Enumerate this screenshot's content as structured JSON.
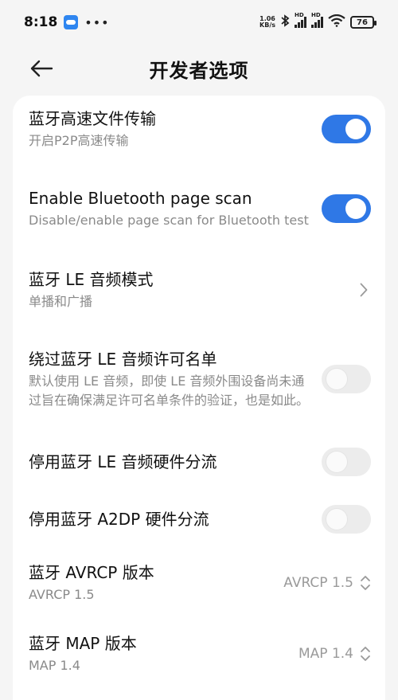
{
  "status_bar": {
    "time": "8:18",
    "net_speed_value": "1.06",
    "net_speed_unit": "KB/s",
    "signal1_label": "HD",
    "signal2_label": "HD",
    "battery": "76",
    "icons": [
      "cloud-icon",
      "more-dots-icon",
      "bluetooth-icon",
      "signal-icon",
      "wifi-icon",
      "battery-icon"
    ]
  },
  "header": {
    "title": "开发者选项"
  },
  "settings": {
    "bt_hs_transfer": {
      "title": "蓝牙高速文件传输",
      "subtitle": "开启P2P高速传输",
      "enabled": true
    },
    "bt_page_scan": {
      "title": "Enable Bluetooth page scan",
      "subtitle": "Disable/enable page scan for Bluetooth test",
      "enabled": true
    },
    "le_audio_mode": {
      "title": "蓝牙 LE 音频模式",
      "subtitle": "单播和广播"
    },
    "bypass_le_allowlist": {
      "title": "绕过蓝牙 LE 音频许可名单",
      "subtitle": "默认使用 LE 音频，即使 LE 音频外围设备尚未通过旨在确保满足许可名单条件的验证，也是如此。",
      "enabled": false
    },
    "disable_le_offload": {
      "title": "停用蓝牙 LE 音频硬件分流",
      "enabled": false
    },
    "disable_a2dp_offload": {
      "title": "停用蓝牙 A2DP 硬件分流",
      "enabled": false
    },
    "avrcp_version": {
      "title": "蓝牙 AVRCP 版本",
      "subtitle": "AVRCP 1.5",
      "value": "AVRCP 1.5"
    },
    "map_version": {
      "title": "蓝牙 MAP 版本",
      "subtitle": "MAP 1.4",
      "value": "MAP 1.4"
    }
  },
  "colors": {
    "accent": "#2f78e6",
    "toggle_off": "#ececec",
    "background": "#f5f5f5",
    "card": "#ffffff",
    "secondary_text": "#8a8a8a"
  }
}
